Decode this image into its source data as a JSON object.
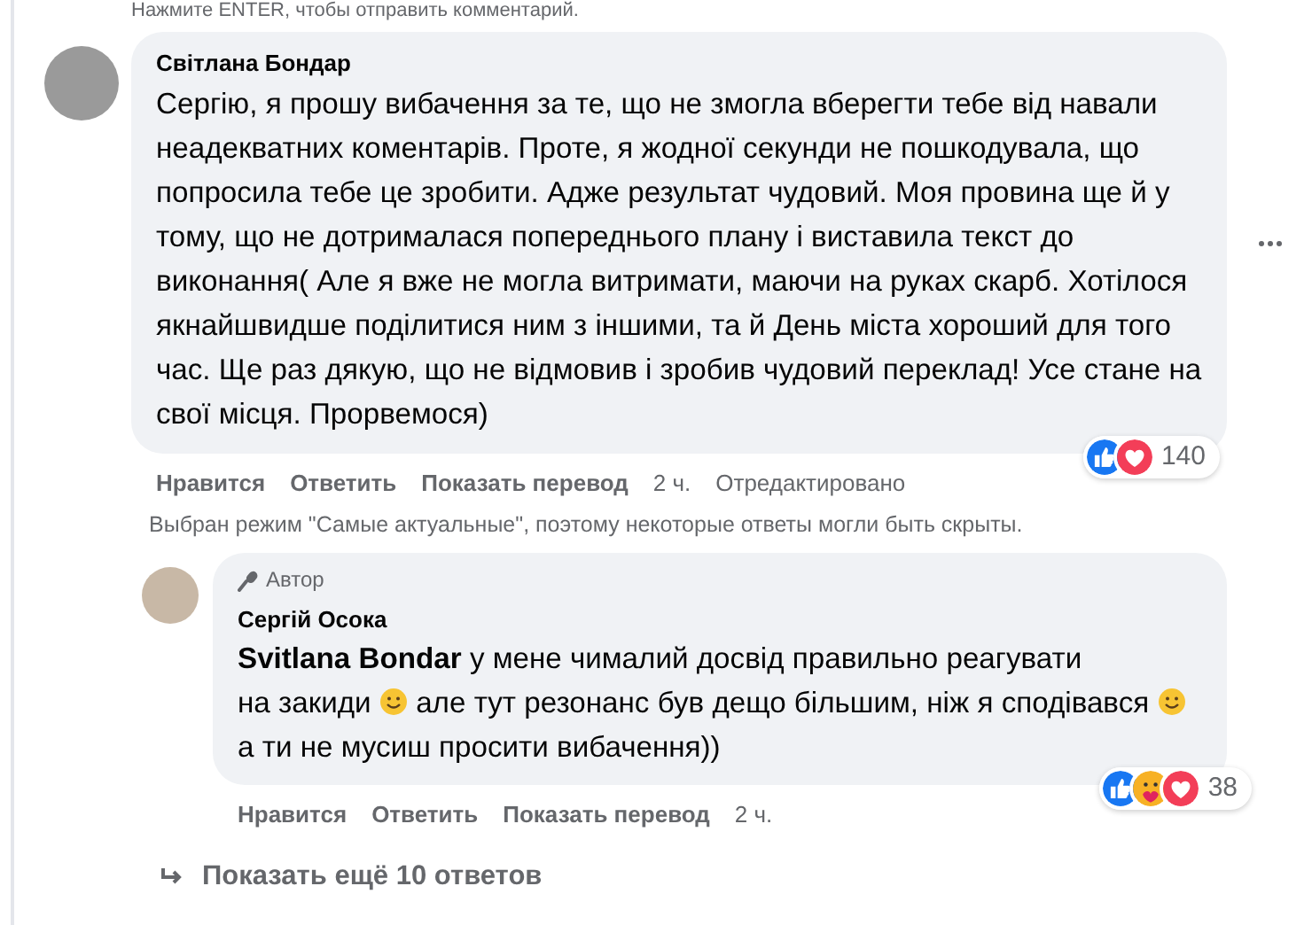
{
  "hint": "Нажмите ENTER, чтобы отправить комментарий.",
  "comment": {
    "author": "Світлана Бондар",
    "text": "Сергію, я прошу вибачення за те, що не змогла вберегти тебе від навали неадекватних коментарів. Проте, я жодної секунди не пошкодувала, що попросила тебе це зробити. Адже результат чудовий. Моя провина ще й у тому, що не дотрималася попереднього плану і виставила текст до виконання( Але я вже не могла витримати, маючи на руках скарб. Хотілося якнайшвидше поділитися ним з іншими, та й День міста хороший для того час. Ще раз дякую, що не відмовив і зробив чудовий переклад! Усе стане на свої місця. Прорвемося)",
    "reactions": [
      {
        "kind": "like"
      },
      {
        "kind": "love"
      }
    ],
    "reaction_count": "140",
    "actions": [
      "Нравится",
      "Ответить",
      "Показать перевод",
      "2 ч.",
      "Отредактировано"
    ]
  },
  "notice": "Выбран режим \"Самые актуальные\", поэтому некоторые ответы могли быть скрыты.",
  "reply": {
    "badge": "Автор",
    "author": "Сергій Осока",
    "body": [
      {
        "kind": "text",
        "text": "**Svitlana Bondar** у мене чималий досвід правильно реагувати"
      },
      {
        "kind": "text",
        "text": "на закиди"
      },
      {
        "kind": "smiley"
      },
      {
        "kind": "text",
        "text": "але тут резонанс був дещо більшим, ніж я"
      },
      {
        "kind": "text",
        "text": "сподівався"
      },
      {
        "kind": "smiley"
      },
      {
        "kind": "text",
        "text": "а ти не мусиш просити вибачення))"
      }
    ],
    "reactions": [
      {
        "kind": "like"
      },
      {
        "kind": "care"
      },
      {
        "kind": "love"
      }
    ],
    "reaction_count": "38",
    "actions": [
      "Нравится",
      "Ответить",
      "Показать перевод",
      "2 ч."
    ]
  },
  "more_replies": "Показать ещё 10 ответов"
}
